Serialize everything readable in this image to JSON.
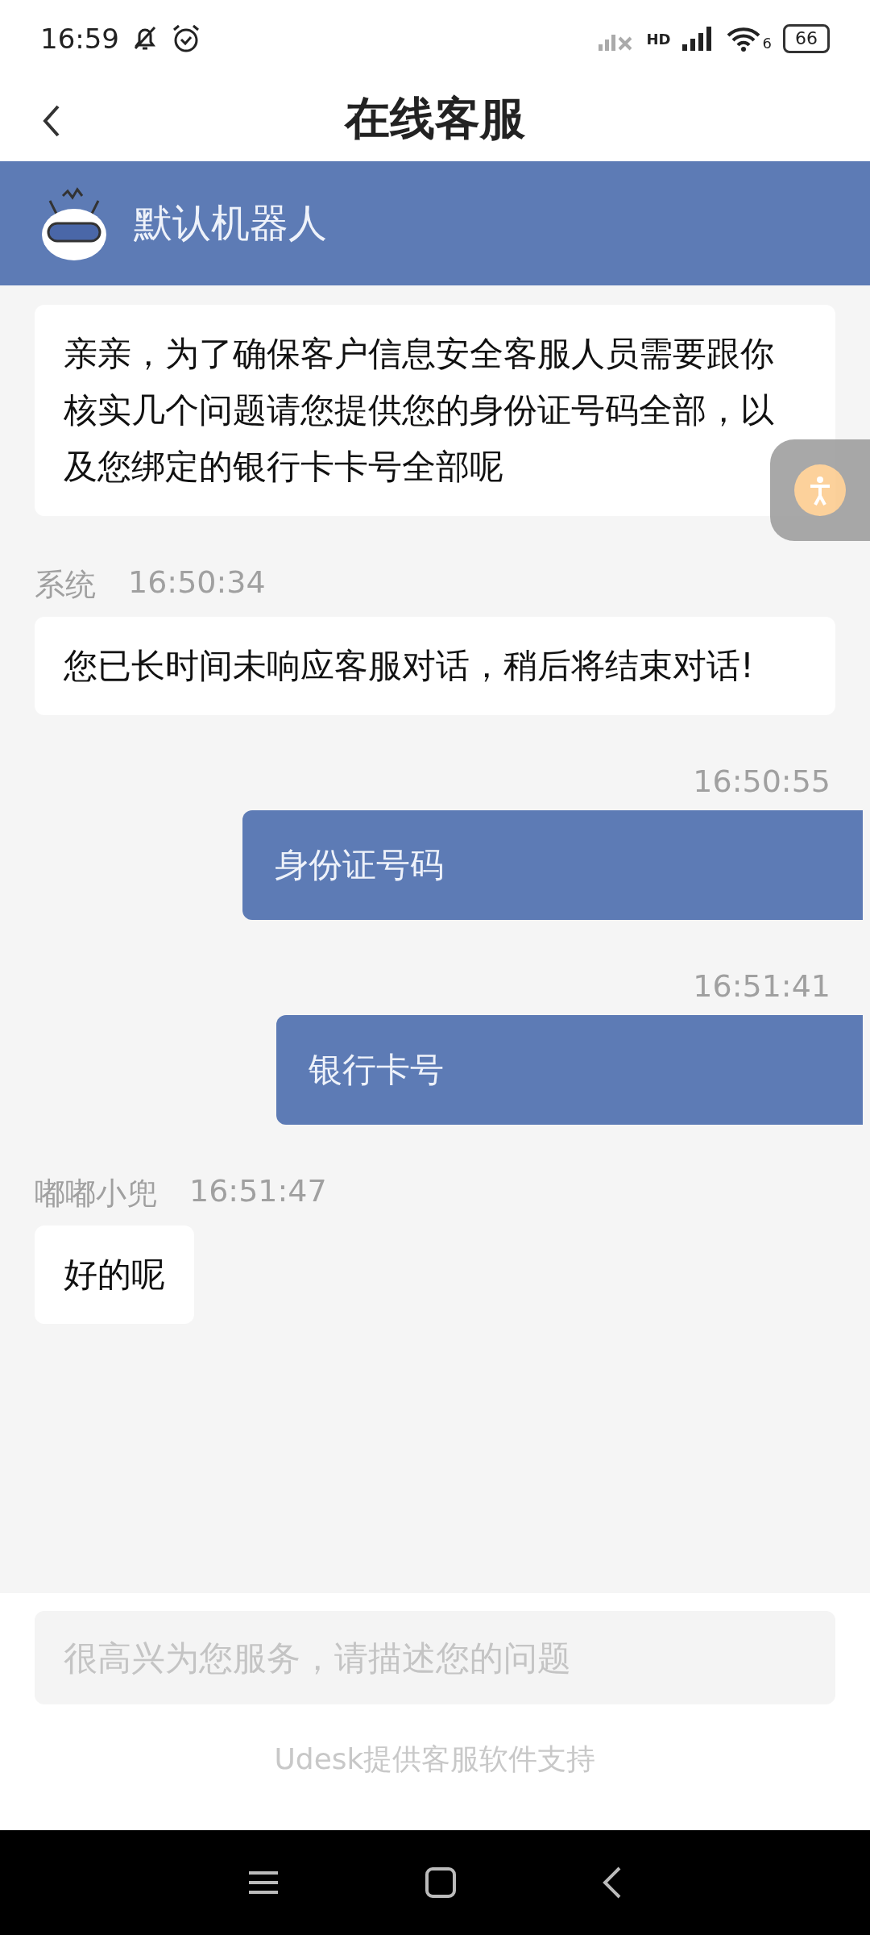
{
  "status_bar": {
    "time": "16:59",
    "network": "HD",
    "wifi": "6",
    "battery": "66"
  },
  "title_bar": {
    "title": "在线客服"
  },
  "agent_header": {
    "name": "默认机器人"
  },
  "messages": [
    {
      "kind": "incoming",
      "text": "亲亲，为了确保客户信息安全客服人员需要跟你核实几个问题请您提供您的身份证号码全部，以及您绑定的银行卡卡号全部呢"
    },
    {
      "kind": "incoming",
      "sender": "系统",
      "time": "16:50:34",
      "text": "您已长时间未响应客服对话，稍后将结束对话!"
    },
    {
      "kind": "outgoing",
      "time": "16:50:55",
      "text": "身份证号码"
    },
    {
      "kind": "outgoing",
      "time": "16:51:41",
      "text": "银行卡号"
    },
    {
      "kind": "incoming",
      "sender": "嘟嘟小兜",
      "time": "16:51:47",
      "text": "好的呢"
    }
  ],
  "input": {
    "placeholder": "很高兴为您服务，请描述您的问题"
  },
  "footer": "Udesk提供客服软件支持"
}
